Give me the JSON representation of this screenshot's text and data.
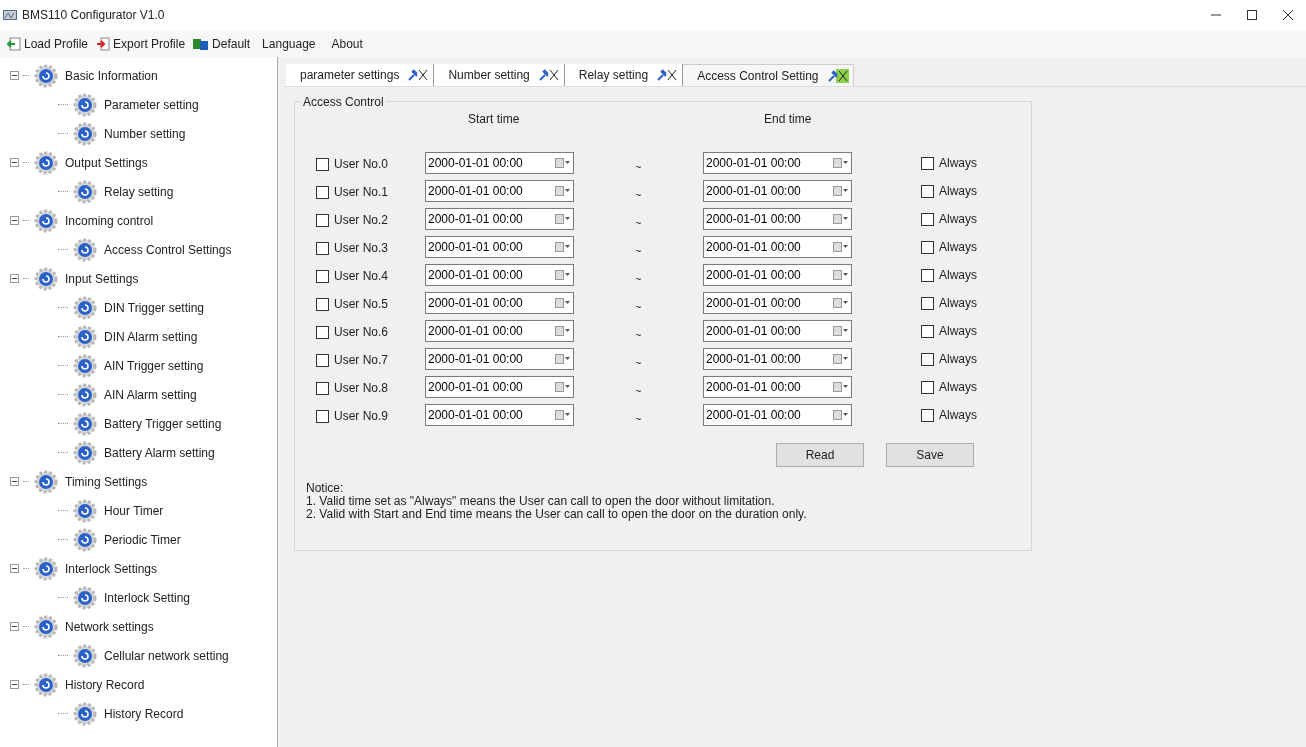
{
  "window": {
    "title": "BMS110 Configurator V1.0"
  },
  "toolbar": [
    {
      "label": "Load Profile",
      "kind": "load"
    },
    {
      "label": "Export Profile",
      "kind": "export"
    },
    {
      "label": "Default",
      "kind": "default"
    },
    {
      "label": "Language",
      "kind": "menu"
    },
    {
      "label": "About",
      "kind": "menu"
    }
  ],
  "tree": [
    {
      "label": "Basic Information",
      "expanded": true,
      "children": [
        {
          "label": "Parameter setting"
        },
        {
          "label": "Number setting"
        }
      ]
    },
    {
      "label": "Output Settings",
      "expanded": true,
      "children": [
        {
          "label": "Relay setting"
        }
      ]
    },
    {
      "label": "Incoming control",
      "expanded": true,
      "children": [
        {
          "label": "Access Control Settings"
        }
      ]
    },
    {
      "label": "Input Settings",
      "expanded": true,
      "children": [
        {
          "label": "DIN Trigger setting"
        },
        {
          "label": "DIN Alarm setting"
        },
        {
          "label": "AIN Trigger setting"
        },
        {
          "label": "AIN Alarm setting"
        },
        {
          "label": "Battery Trigger setting"
        },
        {
          "label": "Battery Alarm setting"
        }
      ]
    },
    {
      "label": "Timing Settings",
      "expanded": true,
      "children": [
        {
          "label": "Hour Timer"
        },
        {
          "label": "Periodic Timer"
        }
      ]
    },
    {
      "label": "Interlock Settings",
      "expanded": true,
      "children": [
        {
          "label": "Interlock Setting"
        }
      ]
    },
    {
      "label": "Network settings",
      "expanded": true,
      "children": [
        {
          "label": "Cellular network setting"
        }
      ]
    },
    {
      "label": "History Record",
      "expanded": true,
      "children": [
        {
          "label": "History Record"
        }
      ]
    }
  ],
  "tabs": [
    {
      "label": "parameter settings",
      "selected": false
    },
    {
      "label": "Number setting",
      "selected": false
    },
    {
      "label": "Relay setting",
      "selected": false
    },
    {
      "label": "Access Control Setting",
      "selected": true
    }
  ],
  "group": {
    "title": "Access Control",
    "start_header": "Start time",
    "end_header": "End time",
    "separator": "~"
  },
  "users": [
    {
      "label": "User No.0",
      "checked": false,
      "start": "2000-01-01 00:00",
      "end": "2000-01-01 00:00",
      "always_label": "Always",
      "always": false
    },
    {
      "label": "User No.1",
      "checked": false,
      "start": "2000-01-01 00:00",
      "end": "2000-01-01 00:00",
      "always_label": "Always",
      "always": false
    },
    {
      "label": "User No.2",
      "checked": false,
      "start": "2000-01-01 00:00",
      "end": "2000-01-01 00:00",
      "always_label": "Always",
      "always": false
    },
    {
      "label": "User No.3",
      "checked": false,
      "start": "2000-01-01 00:00",
      "end": "2000-01-01 00:00",
      "always_label": "Always",
      "always": false
    },
    {
      "label": "User No.4",
      "checked": false,
      "start": "2000-01-01 00:00",
      "end": "2000-01-01 00:00",
      "always_label": "Always",
      "always": false
    },
    {
      "label": "User No.5",
      "checked": false,
      "start": "2000-01-01 00:00",
      "end": "2000-01-01 00:00",
      "always_label": "Always",
      "always": false
    },
    {
      "label": "User No.6",
      "checked": false,
      "start": "2000-01-01 00:00",
      "end": "2000-01-01 00:00",
      "always_label": "Always",
      "always": false
    },
    {
      "label": "User No.7",
      "checked": false,
      "start": "2000-01-01 00:00",
      "end": "2000-01-01 00:00",
      "always_label": "Always",
      "always": false
    },
    {
      "label": "User No.8",
      "checked": false,
      "start": "2000-01-01 00:00",
      "end": "2000-01-01 00:00",
      "always_label": "Always",
      "always": false
    },
    {
      "label": "User No.9",
      "checked": false,
      "start": "2000-01-01 00:00",
      "end": "2000-01-01 00:00",
      "always_label": "Always",
      "always": false
    }
  ],
  "buttons": [
    "Read",
    "Save"
  ],
  "notice": [
    "Notice:",
    "1. Valid time set as \"Always\" means the User can call to open the door without limitation.",
    "2. Valid with Start and End time means the User can call to open the door on the duration only."
  ]
}
